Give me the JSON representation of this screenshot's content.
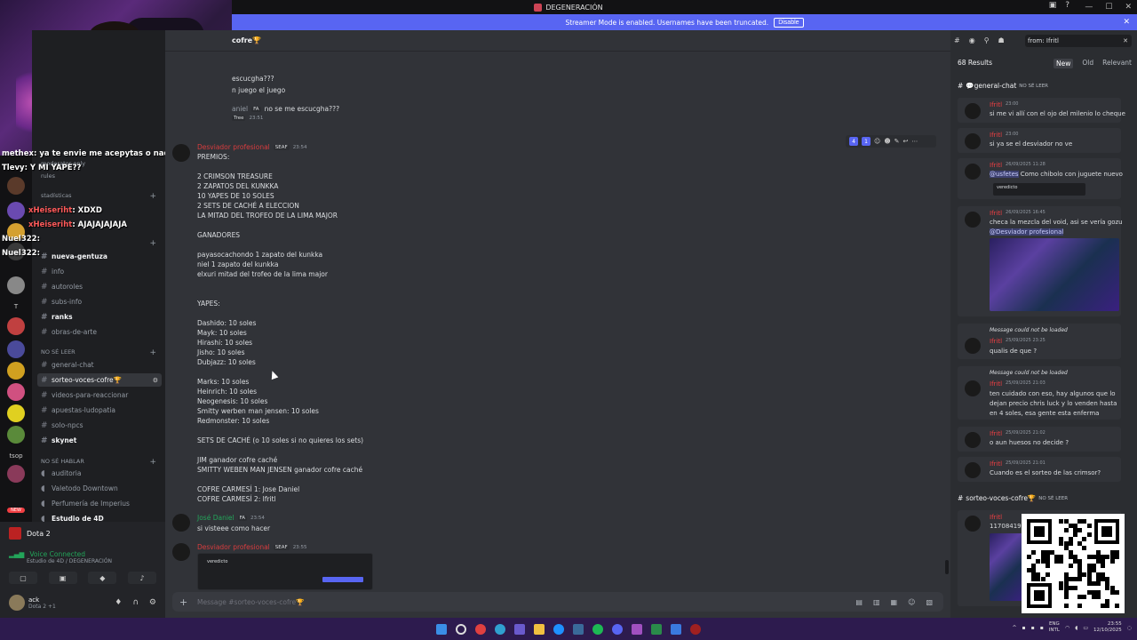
{
  "window": {
    "title": "DEGENERACIÓN",
    "controls": [
      "—",
      "☐",
      "✕"
    ]
  },
  "banner": {
    "text": "Streamer Mode is enabled. Usernames have been truncated.",
    "button": "Disable"
  },
  "servers": {
    "labels": [
      "T",
      "tsop",
      "NEW"
    ]
  },
  "channels": {
    "top_lines": [
      "moderator-only",
      "rules",
      "stadísticas"
    ],
    "items": [
      {
        "name": "nueva-gentuza",
        "bold": true
      },
      {
        "name": "info",
        "bold": false
      },
      {
        "name": "autoroles",
        "bold": false
      },
      {
        "name": "subs-info",
        "bold": false
      },
      {
        "name": "ranks",
        "bold": true
      },
      {
        "name": "obras-de-arte",
        "bold": false
      }
    ],
    "category_no_se_leer": "NO SÉ LEER",
    "items2": [
      {
        "name": "general-chat",
        "bold": false
      },
      {
        "name": "sorteo-voces-cofre🏆",
        "active": true
      },
      {
        "name": "videos-para-reaccionar",
        "bold": false
      },
      {
        "name": "apuestas-ludopatia",
        "bold": false
      },
      {
        "name": "solo-npcs",
        "bold": false
      },
      {
        "name": "skynet",
        "bold": true
      }
    ],
    "category_no_se_hablar": "NO SÉ HABLAR",
    "voice": [
      "auditoria",
      "Valetodo Downtown",
      "Perfumería de Imperius",
      "Estudio de 4D"
    ]
  },
  "stream_chat": [
    {
      "name": "methex",
      "text": ": ya te envie me acepytas o nada"
    },
    {
      "name": "Tlevy",
      "text": ": Y MI YAPE??"
    },
    {
      "name": "xHeiseriht",
      "text": ": XDXD"
    },
    {
      "name": "xHeiseriht",
      "text": ": AJAJAJAJAJA"
    },
    {
      "name": "Nuel322",
      "text": ":"
    },
    {
      "name": "Nuel322",
      "text": ":"
    }
  ],
  "voice_panel": {
    "game": "Dota 2",
    "status": "Voice Connected",
    "channel": "Estudio de 4D / DEGENERACIÓN",
    "user_name": "ack",
    "user_status": "Dota 2 +1"
  },
  "chat": {
    "header": "cofre🏆",
    "composer_placeholder": "Message #sorteo-voces-cofre🏆",
    "top_lines": [
      "escucgha???",
      "n juego el juego"
    ],
    "top_author": {
      "name": "aniel",
      "tag": "FA",
      "text": "no se me escucgha???",
      "time": "23:51",
      "sub": "Tree"
    },
    "main_author": {
      "name": "Desviador profesional",
      "tag": "SEAF",
      "time": "23:54"
    },
    "hover_nums": [
      "4",
      "1"
    ],
    "lines": [
      "PREMIOS:",
      "",
      "2 CRIMSON TREASURE",
      "2 ZAPATOS DEL KUNKKA",
      "10 YAPES DE 10 SOLES",
      "2 SETS DE CACHÉ A ELECCION",
      "LA MITAD DEL TROFEO DE LA LIMA MAJOR",
      "",
      "GANADORES",
      "",
      "payasocachondo 1 zapato del kunkka",
      "niel 1 zapato del kunkka",
      "elxuri mitad del trofeo de la lima major",
      "",
      "",
      "YAPES:",
      "",
      "Dashido: 10 soles",
      "Mayk: 10 soles",
      "Hirashi: 10 soles",
      "Jisho: 10 soles",
      "Dubjazz: 10 soles",
      "",
      "Marks: 10 soles",
      "Heinrich: 10 soles",
      "Neogenesis: 10 soles",
      "Smitty werben man jensen: 10 soles",
      "Redmonster: 10 soles",
      "",
      "SETS DE CACHÉ (o 10 soles si no quieres los sets)",
      "",
      "JIM ganador cofre caché",
      "SMITTY WEBEN MAN JENSEN ganador cofre caché",
      "",
      "COFRE CARMESÍ 1: Jose Daniel",
      "COFRE CARMESÍ 2: Ifritl"
    ],
    "msg2": {
      "name": "José Daniel",
      "tag": "FA",
      "time": "23:54",
      "text": "si visteee como hacer"
    },
    "msg3": {
      "name": "Desviador profesional",
      "tag": "SEAF",
      "time": "23:55",
      "embed_title": "veredicto"
    }
  },
  "search": {
    "query": "from: Ifritl",
    "results_count": "68 Results",
    "sorts": [
      "New",
      "Old",
      "Relevant"
    ],
    "group1": {
      "channel": "💬general-chat",
      "category": "NO SÉ LEER"
    },
    "group2": {
      "channel": "sorteo-voces-cofre🏆",
      "category": "NO SÉ LEER"
    },
    "not_loaded": "Message could not be loaded",
    "results": [
      {
        "name": "Ifritl",
        "time": "23:00",
        "text": [
          "si me vi allí con el ojo del milenio lo cheque"
        ]
      },
      {
        "name": "Ifritl",
        "time": "23:00",
        "text": [
          "si ya se el desviador no ve"
        ]
      },
      {
        "name": "Ifritl",
        "time": "26/09/2025 11:28",
        "text": [
          "Como chibolo con juguete nuevo"
        ],
        "mention": "@usfetes",
        "embed": "veredicto"
      },
      {
        "name": "Ifritl",
        "time": "26/09/2025 16:45",
        "text": [
          "checa la mezcla del void, asi se vería gozu"
        ],
        "mention": "@Desviador profesional"
      },
      {
        "name": "Ifritl",
        "time": "25/09/2025 23:25",
        "text": [
          "qualis de que ?"
        ]
      },
      {
        "name": "Ifritl",
        "time": "25/09/2025 21:03",
        "text": [
          "ten cuidado con eso, hay algunos que lo",
          "dejan precio chris luck y lo venden hasta",
          "en 4 soles, esa gente esta enferma"
        ]
      },
      {
        "name": "Ifritl",
        "time": "25/09/2025 21:02",
        "text": [
          "o aun huesos no decide ?"
        ]
      },
      {
        "name": "Ifritl",
        "time": "25/09/2025 21:01",
        "text": [
          "Cuando es el sorteo de las crimsor?"
        ]
      },
      {
        "name": "Ifritl",
        "time": "",
        "text": [
          "117084197"
        ]
      }
    ]
  },
  "taskbar": {
    "lang": [
      "ENG",
      "INTL"
    ],
    "time": "23:55",
    "date": "12/10/2025"
  },
  "colors": {
    "accent": "#5865f2",
    "taskbar": "#2d1b4e",
    "mention": "#f23f43",
    "online": "#23a55a"
  }
}
